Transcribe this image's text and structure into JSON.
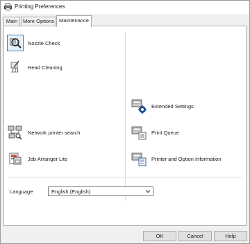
{
  "window": {
    "title": "Printing Preferences"
  },
  "tabs": [
    {
      "label": "Main"
    },
    {
      "label": "More Options"
    },
    {
      "label": "Maintenance"
    }
  ],
  "left_items": [
    {
      "label": "Nozzle Check",
      "icon": "nozzle-check-icon"
    },
    {
      "label": "Head Cleaning",
      "icon": "head-cleaning-icon"
    },
    {
      "label": "Network printer search",
      "icon": "network-printer-search-icon"
    },
    {
      "label": "Job Arranger Lite",
      "icon": "job-arranger-icon"
    }
  ],
  "right_items": [
    {
      "label": "Extended Settings",
      "icon": "extended-settings-icon"
    },
    {
      "label": "Print Queue",
      "icon": "print-queue-icon"
    },
    {
      "label": "Printer and Option Information",
      "icon": "printer-info-icon"
    }
  ],
  "language": {
    "label": "Language",
    "value": "English (English)"
  },
  "buttons": {
    "ok": "OK",
    "cancel": "Cancel",
    "help": "Help"
  },
  "colors": {
    "selection_border": "#3c7fb1",
    "selection_fill": "#e5f1fb",
    "button_face": "#e1e1e1"
  }
}
